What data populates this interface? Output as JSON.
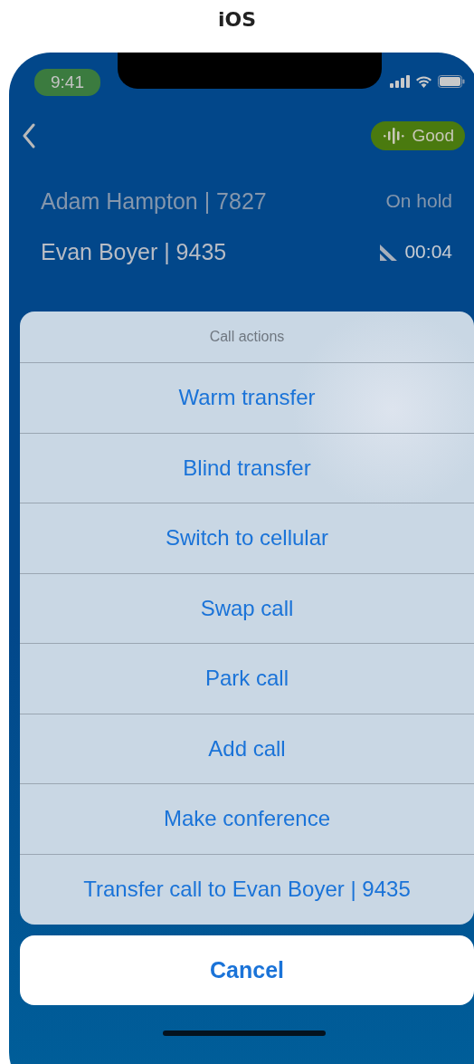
{
  "caption": "iOS",
  "status_bar": {
    "time": "9:41"
  },
  "nav": {
    "quality_badge": "Good"
  },
  "calls": [
    {
      "kind": "held",
      "name": "Adam Hampton | 7827",
      "status": "On hold"
    },
    {
      "kind": "active",
      "name": "Evan Boyer | 9435",
      "status": "00:04"
    }
  ],
  "action_sheet": {
    "title": "Call actions",
    "actions": [
      "Warm transfer",
      "Blind transfer",
      "Switch to cellular",
      "Swap call",
      "Park call",
      "Add call",
      "Make conference",
      "Transfer call to Evan Boyer | 9435"
    ],
    "cancel": "Cancel"
  }
}
